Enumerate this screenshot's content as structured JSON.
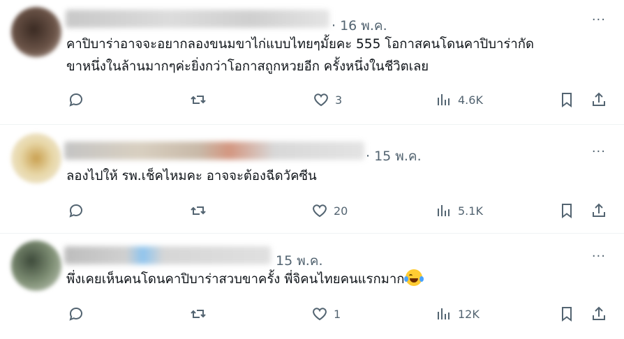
{
  "tweets": [
    {
      "date": "· 16 พ.ค.",
      "text_line1": "คาปิบาร่าอาจจะอยากลองขนมขาไก่แบบไทยๆมั้ยคะ 555 โอกาสคนโดนคาปิบาร่ากัด",
      "text_line2": "ขาหนึ่งในล้านมากๆค่ะยิ่งกว่าโอกาสถูกหวยอีก ครั้งหนึ่งในชีวิตเลย",
      "likes": "3",
      "views": "4.6K"
    },
    {
      "date": "· 15 พ.ค.",
      "text_line1": "ลองไปให้ รพ.เช็คไหมคะ อาจจะต้องฉีดวัคซีน",
      "text_line2": "",
      "likes": "20",
      "views": "5.1K"
    },
    {
      "date": "15 พ.ค.",
      "text_line1": "พึ่งเคยเห็นคนโดนคาปิบาร่าสวบขาครั้ง พี่จิคนไทยคนแรกมาก",
      "text_line2": "",
      "likes": "1",
      "views": "12K"
    }
  ],
  "more_label": "···",
  "icons": [
    "reply-icon",
    "retweet-icon",
    "like-icon",
    "views-icon",
    "bookmark-icon",
    "share-icon",
    "laughing-emoji-icon"
  ],
  "colors": {
    "text": "#0f1419",
    "muted": "#536471",
    "divider": "#eff3f4"
  }
}
